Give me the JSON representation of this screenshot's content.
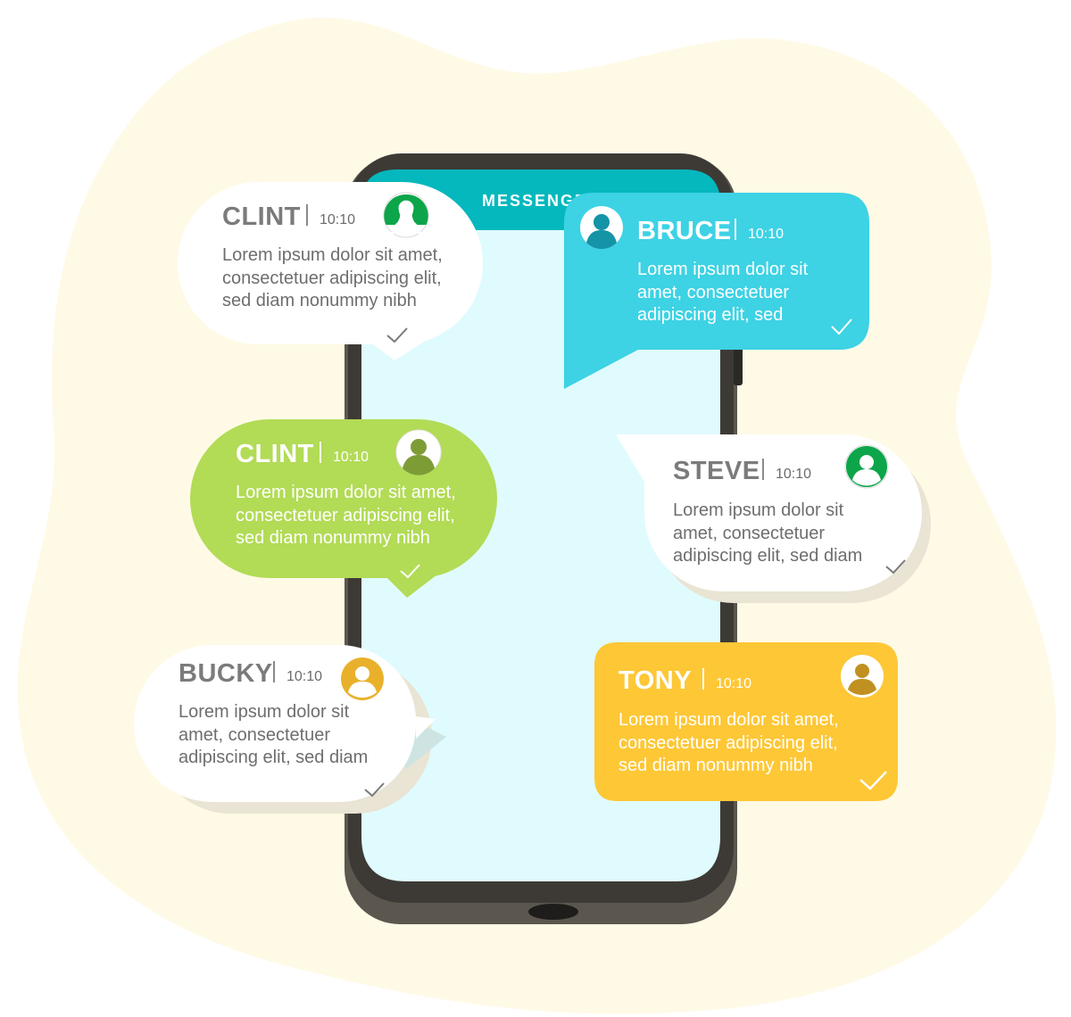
{
  "app": {
    "header_title": "MESSENGER"
  },
  "colors": {
    "blob": "#fffae6",
    "phone_body": "#3d3a36",
    "screen": "#e0fbfd",
    "header": "#04b8bd",
    "white_bubble": "#ffffff",
    "bruce": "#3dd2e4",
    "clint_green": "#b2db56",
    "tony": "#fdc736"
  },
  "messages": [
    {
      "id": "clint1",
      "name": "CLINT",
      "time": "10:10",
      "lines": [
        "Lorem ipsum dolor sit amet,",
        "consectetuer adipiscing elit,",
        "sed diam nonummy nibh"
      ],
      "avatar_icon": "user-avatar-icon",
      "avatar_color": "#0da54a",
      "status_icon": "checkmark-icon"
    },
    {
      "id": "bruce",
      "name": "BRUCE",
      "time": "10:10",
      "lines": [
        "Lorem ipsum dolor sit",
        "amet, consectetuer",
        "adipiscing elit, sed"
      ],
      "avatar_icon": "user-avatar-icon",
      "avatar_color": "#1494a6",
      "status_icon": "checkmark-icon"
    },
    {
      "id": "clint2",
      "name": "CLINT",
      "time": "10:10",
      "lines": [
        "Lorem ipsum dolor sit amet,",
        "consectetuer adipiscing elit,",
        "sed diam nonummy nibh"
      ],
      "avatar_icon": "user-avatar-icon",
      "avatar_color": "#7e9c36",
      "status_icon": "checkmark-icon"
    },
    {
      "id": "steve",
      "name": "STEVE",
      "time": "10:10",
      "lines": [
        "Lorem ipsum dolor sit",
        "amet, consectetuer",
        "adipiscing elit, sed diam"
      ],
      "avatar_icon": "user-avatar-icon",
      "avatar_color": "#0da54a",
      "status_icon": "checkmark-icon"
    },
    {
      "id": "bucky",
      "name": "BUCKY",
      "time": "10:10",
      "lines": [
        "Lorem ipsum dolor sit",
        "amet, consectetuer",
        "adipiscing elit, sed diam"
      ],
      "avatar_icon": "user-avatar-icon",
      "avatar_color": "#e9b12b",
      "status_icon": "checkmark-icon"
    },
    {
      "id": "tony",
      "name": "TONY",
      "time": "10:10",
      "lines": [
        "Lorem ipsum dolor sit amet,",
        "consectetuer adipiscing elit,",
        "sed diam nonummy nibh"
      ],
      "avatar_icon": "user-avatar-icon",
      "avatar_color": "#c09021",
      "status_icon": "checkmark-icon"
    }
  ]
}
